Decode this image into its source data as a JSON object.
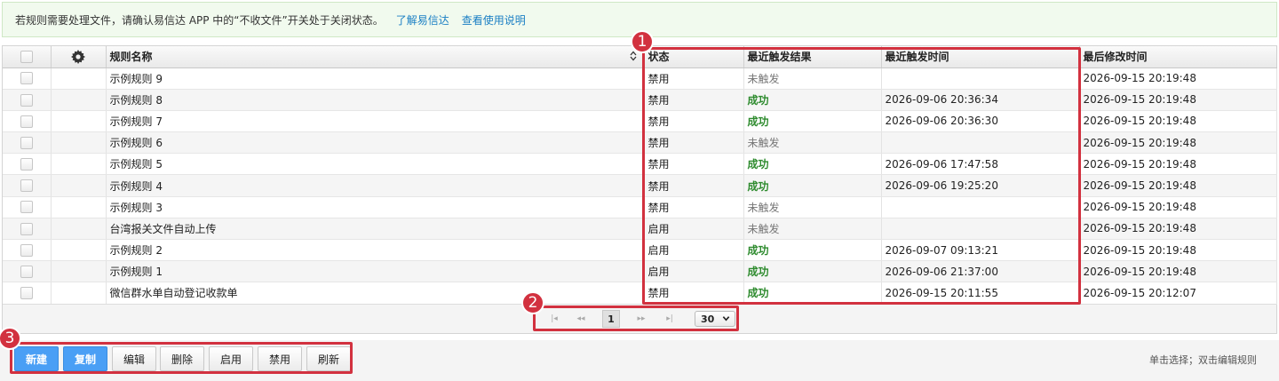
{
  "notice": {
    "message": "若规则需要处理文件，请确认易信达 APP 中的“不收文件”开关处于关闭状态。",
    "link1": "了解易信达",
    "link2": "查看使用说明"
  },
  "table": {
    "headers": [
      "规则名称",
      "状态",
      "最近触发结果",
      "最近触发时间",
      "最后修改时间"
    ],
    "rows": [
      {
        "name": "示例规则 9",
        "status": "禁用",
        "result": "未触发",
        "time": "",
        "modified": "2026-09-15 20:19:48"
      },
      {
        "name": "示例规则 8",
        "status": "禁用",
        "result": "成功",
        "time": "2026-09-06 20:36:34",
        "modified": "2026-09-15 20:19:48"
      },
      {
        "name": "示例规则 7",
        "status": "禁用",
        "result": "成功",
        "time": "2026-09-06 20:36:30",
        "modified": "2026-09-15 20:19:48"
      },
      {
        "name": "示例规则 6",
        "status": "禁用",
        "result": "未触发",
        "time": "",
        "modified": "2026-09-15 20:19:48"
      },
      {
        "name": "示例规则 5",
        "status": "禁用",
        "result": "成功",
        "time": "2026-09-06 17:47:58",
        "modified": "2026-09-15 20:19:48"
      },
      {
        "name": "示例规则 4",
        "status": "禁用",
        "result": "成功",
        "time": "2026-09-06 19:25:20",
        "modified": "2026-09-15 20:19:48"
      },
      {
        "name": "示例规则 3",
        "status": "禁用",
        "result": "未触发",
        "time": "",
        "modified": "2026-09-15 20:19:48"
      },
      {
        "name": "台湾报关文件自动上传",
        "status": "启用",
        "result": "未触发",
        "time": "",
        "modified": "2026-09-15 20:19:48"
      },
      {
        "name": "示例规则 2",
        "status": "启用",
        "result": "成功",
        "time": "2026-09-07 09:13:21",
        "modified": "2026-09-15 20:19:48"
      },
      {
        "name": "示例规则 1",
        "status": "启用",
        "result": "成功",
        "time": "2026-09-06 21:37:00",
        "modified": "2026-09-15 20:19:48"
      },
      {
        "name": "微信群水单自动登记收款单",
        "status": "禁用",
        "result": "成功",
        "time": "2026-09-15 20:11:55",
        "modified": "2026-09-15 20:12:07"
      }
    ]
  },
  "pager": {
    "page": "1",
    "page_size": "30",
    "first_icon": "first-page-icon",
    "prev_icon": "prev-page-icon",
    "next_icon": "next-page-icon",
    "last_icon": "last-page-icon"
  },
  "toolbar": {
    "new": "新建",
    "copy": "复制",
    "edit": "编辑",
    "delete": "删除",
    "enable": "启用",
    "disable": "禁用",
    "refresh": "刷新",
    "hint": "单击选择；双击编辑规则"
  },
  "annotations": {
    "badge1": "1",
    "badge2": "2",
    "badge3": "3",
    "color": "#d2313f"
  },
  "colors": {
    "success": "#2e8b2e",
    "primary_button": "#4a9ff5",
    "link": "#1a7fc4"
  }
}
